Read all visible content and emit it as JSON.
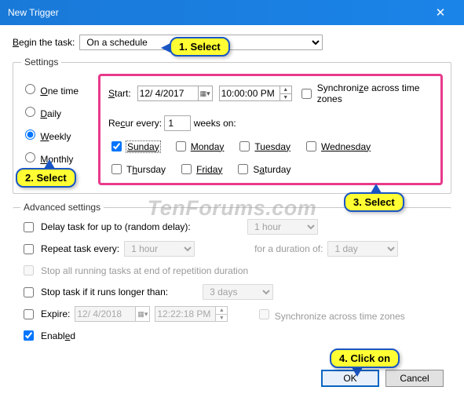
{
  "window": {
    "title": "New Trigger",
    "close": "✕"
  },
  "begin": {
    "label": "Begin the task:",
    "value": "On a schedule"
  },
  "settings": {
    "legend": "Settings",
    "radios": {
      "one_time": "One time",
      "daily": "Daily",
      "weekly": "Weekly",
      "monthly": "Monthly"
    },
    "start_label": "Start:",
    "date": "12/ 4/2017",
    "time": "10:00:00 PM",
    "sync_label": "Synchronize across time zones",
    "recur_label_a": "Recur every:",
    "recur_value": "1",
    "recur_label_b": "weeks on:",
    "days": {
      "sun": "Sunday",
      "mon": "Monday",
      "tue": "Tuesday",
      "wed": "Wednesday",
      "thu": "Thursday",
      "fri": "Friday",
      "sat": "Saturday"
    }
  },
  "adv": {
    "legend": "Advanced settings",
    "delay_label": "Delay task for up to (random delay):",
    "delay_value": "1 hour",
    "repeat_label": "Repeat task every:",
    "repeat_value": "1 hour",
    "duration_label": "for a duration of:",
    "duration_value": "1 day",
    "stop_running_label": "Stop all running tasks at end of repetition duration",
    "stop_if_label": "Stop task if it runs longer than:",
    "stop_if_value": "3 days",
    "expire_label": "Expire:",
    "expire_date": "12/ 4/2018",
    "expire_time": "12:22:18 PM",
    "expire_sync": "Synchronize across time zones",
    "enabled_label": "Enabled"
  },
  "buttons": {
    "ok": "OK",
    "cancel": "Cancel"
  },
  "callouts": {
    "c1": "1. Select",
    "c2": "2. Select",
    "c3": "3. Select",
    "c4": "4. Click on"
  },
  "watermark": "TenForums.com"
}
